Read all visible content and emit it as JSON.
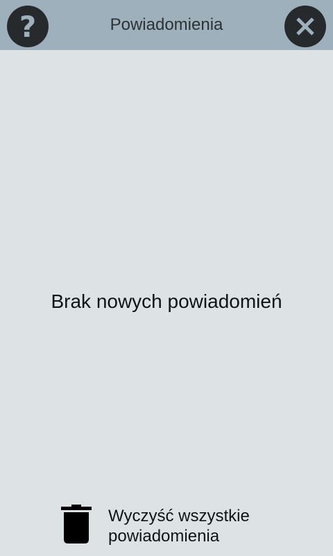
{
  "header": {
    "title": "Powiadomienia",
    "help_icon": "help-icon",
    "help_glyph": "?",
    "close_icon": "close-icon",
    "background_color": "#9eb0bb"
  },
  "main": {
    "empty_message": "Brak nowych powiadomień"
  },
  "footer": {
    "clear_all_line1": "Wyczyść wszystkie",
    "clear_all_line2": "powiadomienia",
    "clear_icon": "trash-icon"
  }
}
